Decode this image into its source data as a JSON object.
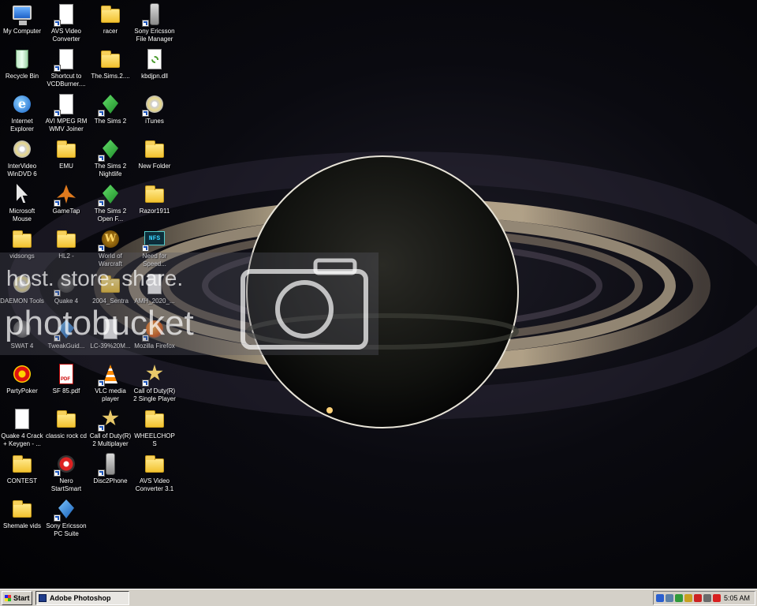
{
  "desktop": {
    "icons": [
      {
        "label": "My Computer",
        "icon": "my-computer-icon"
      },
      {
        "label": "AVS Video Converter",
        "icon": "avs-video-converter-icon"
      },
      {
        "label": "racer",
        "icon": "folder-icon"
      },
      {
        "label": "Sony Ericsson File Manager",
        "icon": "phone-icon"
      },
      {
        "label": "Recycle Bin",
        "icon": "recycle-bin-icon"
      },
      {
        "label": "Shortcut to VCDBurner....",
        "icon": "vcd-burner-icon"
      },
      {
        "label": "The.Sims.2....",
        "icon": "folder-icon"
      },
      {
        "label": "kbdjpn.dll",
        "icon": "dll-file-icon"
      },
      {
        "label": "Internet Explorer",
        "icon": "internet-explorer-icon"
      },
      {
        "label": "AVI MPEG RM WMV Joiner",
        "icon": "video-joiner-icon"
      },
      {
        "label": "The Sims 2",
        "icon": "sims-plumbob-icon"
      },
      {
        "label": "iTunes",
        "icon": "itunes-icon"
      },
      {
        "label": "InterVideo WinDVD 6",
        "icon": "windvd-disc-icon"
      },
      {
        "label": "EMU",
        "icon": "folder-icon"
      },
      {
        "label": "The Sims 2 Nightlife",
        "icon": "sims-plumbob-icon"
      },
      {
        "label": "New Folder",
        "icon": "folder-icon"
      },
      {
        "label": "Microsoft Mouse",
        "icon": "mouse-pointer-icon"
      },
      {
        "label": "GameTap",
        "icon": "gametap-icon"
      },
      {
        "label": "The Sims 2 Open F...",
        "icon": "sims-plumbob-icon"
      },
      {
        "label": "Razor1911",
        "icon": "folder-icon"
      },
      {
        "label": "vidsongs",
        "icon": "folder-icon"
      },
      {
        "label": "HL2 -",
        "icon": "folder-icon"
      },
      {
        "label": "World of Warcraft",
        "icon": "warcraft-icon"
      },
      {
        "label": "Need for Speed...",
        "icon": "need-for-speed-icon"
      },
      {
        "label": "DAEMON Tools",
        "icon": "daemon-tools-icon"
      },
      {
        "label": "Quake 4",
        "icon": "quake-icon"
      },
      {
        "label": "2004_Sentra",
        "icon": "folder-icon"
      },
      {
        "label": "AMH_2020_...",
        "icon": "word-document-icon"
      },
      {
        "label": "SWAT 4",
        "icon": "swat-icon"
      },
      {
        "label": "TweakGuid...",
        "icon": "tweakguide-icon"
      },
      {
        "label": "LC-39%20M...",
        "icon": "document-icon"
      },
      {
        "label": "Mozilla Firefox",
        "icon": "firefox-icon"
      },
      {
        "label": "PartyPoker",
        "icon": "poker-chip-icon"
      },
      {
        "label": "SF 85.pdf",
        "icon": "pdf-icon"
      },
      {
        "label": "VLC media player",
        "icon": "vlc-cone-icon"
      },
      {
        "label": "Call of Duty(R) 2 Single Player",
        "icon": "call-of-duty-icon"
      },
      {
        "label": "Quake 4 Crack + Keygen - ...",
        "icon": "keygen-icon"
      },
      {
        "label": "classic rock cd",
        "icon": "folder-icon"
      },
      {
        "label": "Call of Duty(R) 2 Multiplayer",
        "icon": "call-of-duty-icon"
      },
      {
        "label": "WHEELCHOPS",
        "icon": "folder-icon"
      },
      {
        "label": "CONTEST",
        "icon": "folder-icon"
      },
      {
        "label": "Nero StartSmart",
        "icon": "nero-icon"
      },
      {
        "label": "Disc2Phone",
        "icon": "phone-icon"
      },
      {
        "label": "AVS Video Converter 3.1",
        "icon": "folder-icon"
      },
      {
        "label": "Shemale vids",
        "icon": "folder-icon"
      },
      {
        "label": "Sony Ericsson PC Suite",
        "icon": "pc-suite-icon"
      }
    ]
  },
  "watermark": {
    "line1": "host. store. share.",
    "line2": "photobucket"
  },
  "taskbar": {
    "start_label": "Start",
    "task_label": "Adobe Photoshop",
    "clock": "5:05 AM",
    "tray_icons": [
      "bluetooth-icon",
      "network-icon",
      "shield-icon",
      "security-icon",
      "aim-icon",
      "volume-icon",
      "antivirus-icon"
    ]
  },
  "colors": {
    "taskbar": "#d4d0c8",
    "desktop": "#020204",
    "label_text": "#ffffff"
  }
}
